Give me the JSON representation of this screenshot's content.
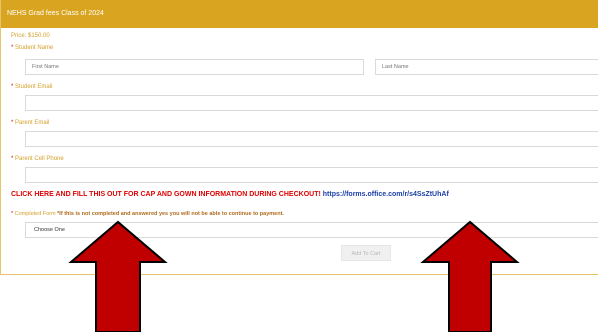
{
  "header": {
    "title": "NEHS Grad fees Class of 2024"
  },
  "price": "Price: $150.00",
  "required_marker": "*",
  "fields": {
    "student_name_label": "Student Name",
    "first_name_placeholder": "First Name",
    "last_name_placeholder": "Last Name",
    "student_email_label": "Student Email",
    "parent_email_label": "Parent Email",
    "parent_cell_label": "Parent Cell Phone"
  },
  "promo": {
    "text": "CLICK HERE AND FILL THIS OUT FOR CAP AND GOWN INFORMATION DURING CHECKOUT!",
    "link": "https://forms.office.com/r/s4SsZtUhAf"
  },
  "completed_form": {
    "label": "Completed Form",
    "note": "*If this is not completed and answered yes you will not be able to continue to payment.",
    "selected": "Choose One"
  },
  "add_to_cart": "Add To Cart",
  "colors": {
    "header": "#d9a521",
    "arrow": "#c00000",
    "promo": "#e00000",
    "link": "#1c3fa8"
  }
}
